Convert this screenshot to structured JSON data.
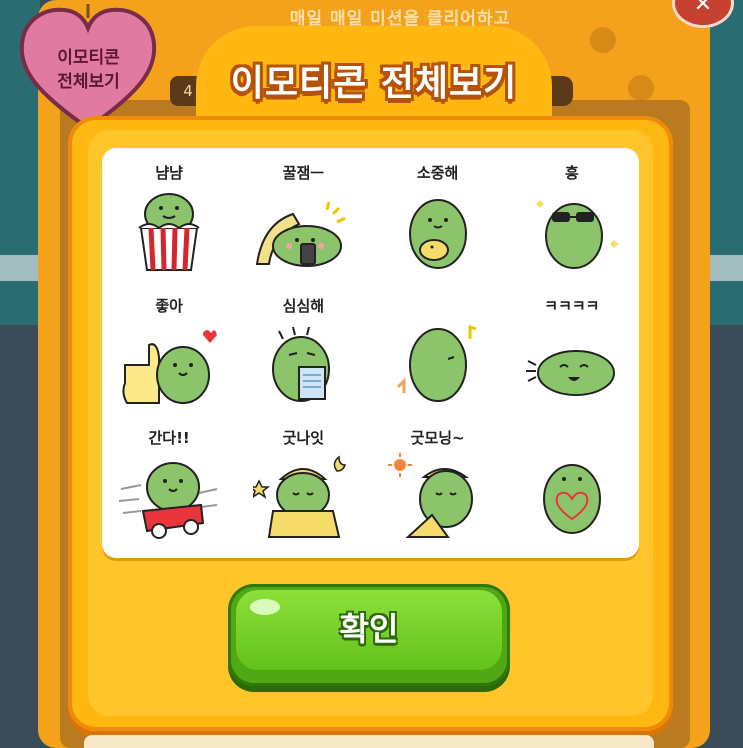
{
  "background": {
    "mission_text": "매일 매일 미션을 클리어하고\n보상을 받아보세요!",
    "side_number": "4",
    "close_icon": "close-icon"
  },
  "badge": {
    "label": "이모티콘\n전체보기"
  },
  "modal": {
    "title": "이모티콘 전체보기",
    "confirm_label": "확인"
  },
  "emoticons": [
    {
      "label": "냠냠",
      "icon": "frog-popcorn-icon"
    },
    {
      "label": "꿀잼ㅡ",
      "icon": "frog-phone-icon"
    },
    {
      "label": "소중해",
      "icon": "frog-hug-duck-icon"
    },
    {
      "label": "흥",
      "icon": "frog-sunglasses-icon"
    },
    {
      "label": "좋아",
      "icon": "frog-thumbs-up-icon"
    },
    {
      "label": "심심해",
      "icon": "frog-book-icon"
    },
    {
      "label": "",
      "icon": "frog-back-dance-icon"
    },
    {
      "label": "ㅋㅋㅋㅋ",
      "icon": "frog-laughing-icon"
    },
    {
      "label": "간다!!",
      "icon": "frog-car-icon"
    },
    {
      "label": "굿나잇",
      "icon": "frog-sleep-icon"
    },
    {
      "label": "굿모닝~",
      "icon": "frog-wakeup-icon"
    },
    {
      "label": "",
      "icon": "frog-heart-icon"
    }
  ],
  "colors": {
    "frog": "#8bc46a",
    "frog_outline": "#222222",
    "modal_orange": "#ffb712",
    "confirm_green": "#63c21a"
  }
}
